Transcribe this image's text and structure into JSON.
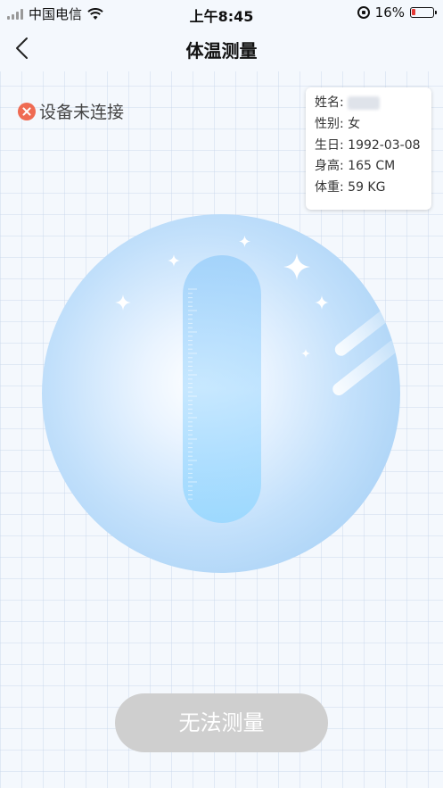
{
  "status_bar": {
    "carrier": "中国电信",
    "time": "上午8:45",
    "battery_percent": "16%",
    "battery_level": 0.16
  },
  "nav": {
    "title": "体温测量"
  },
  "device": {
    "status_text": "设备未连接"
  },
  "profile": {
    "name_label": "姓名:",
    "gender_label": "性别:",
    "gender_value": "女",
    "birthday_label": "生日:",
    "birthday_value": "1992-03-08",
    "height_label": "身高:",
    "height_value": "165 CM",
    "weight_label": "体重:",
    "weight_value": "59 KG"
  },
  "action": {
    "label": "无法测量"
  },
  "colors": {
    "error": "#ef6b53",
    "button_disabled": "#cfcfcf",
    "battery_low": "#e53935"
  }
}
